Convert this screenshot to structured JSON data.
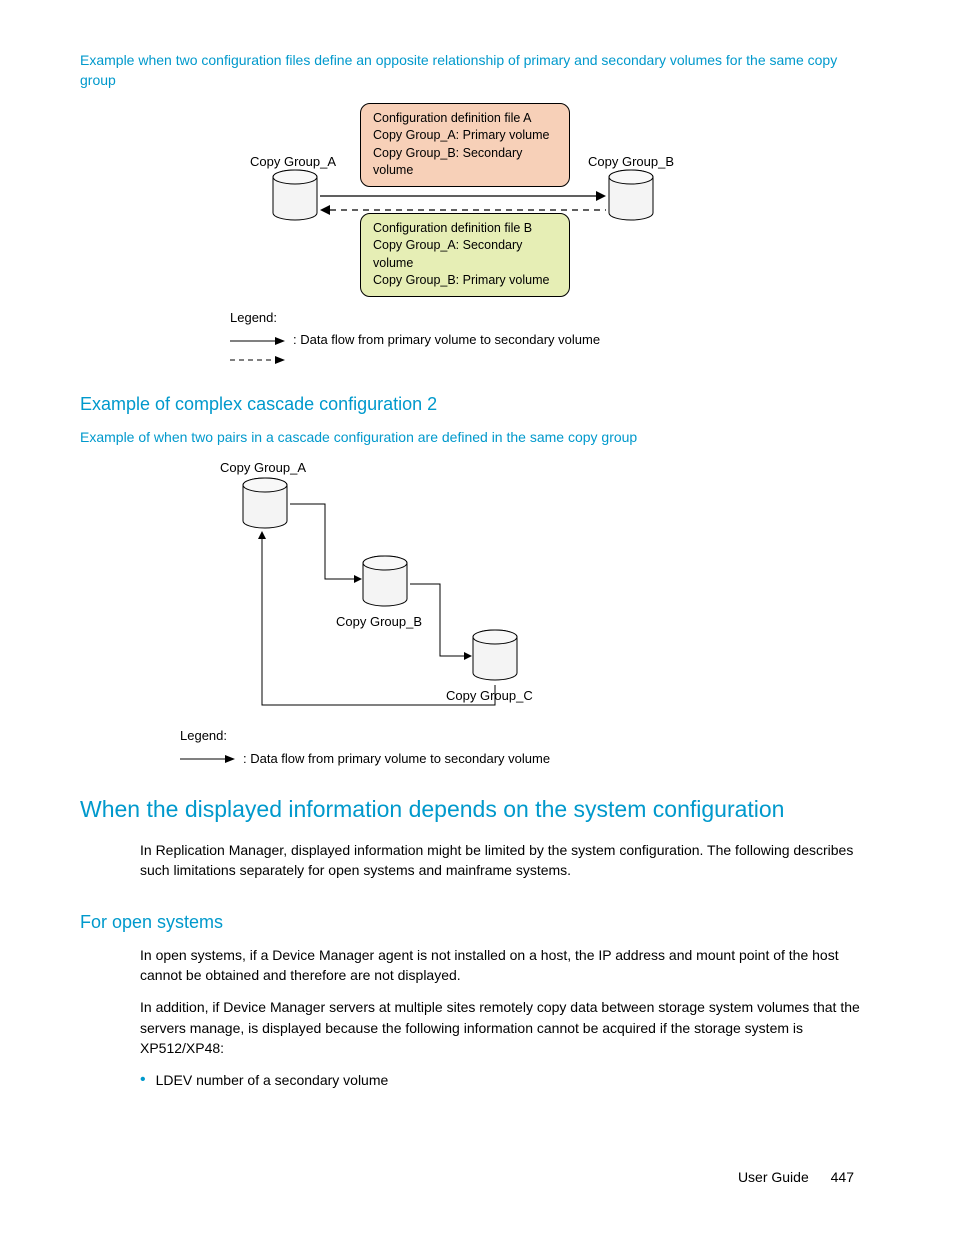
{
  "intro_link": "Example when two configuration files define an opposite relationship of primary and secondary volumes for the same copy group",
  "diagram1": {
    "boxA": {
      "line1": "Configuration definition file A",
      "line2": "Copy Group_A: Primary volume",
      "line3": "Copy Group_B: Secondary volume"
    },
    "boxB": {
      "line1": "Configuration definition file B",
      "line2": "Copy Group_A: Secondary volume",
      "line3": "Copy Group_B: Primary volume"
    },
    "leftLabel": "Copy Group_A",
    "rightLabel": "Copy Group_B",
    "legendTitle": "Legend:",
    "legendText": ": Data flow from primary volume to secondary volume"
  },
  "section2": {
    "heading": "Example of complex cascade configuration 2",
    "linkText": "Example of when two pairs in a cascade configuration are defined in the same copy group"
  },
  "diagram2": {
    "labelA": "Copy Group_A",
    "labelB": "Copy Group_B",
    "labelC": "Copy Group_C",
    "legendTitle": "Legend:",
    "legendText": ": Data flow from primary volume to secondary volume"
  },
  "section3": {
    "heading": "When the displayed information depends on the system configuration",
    "para": "In Replication Manager, displayed information might be limited by the system configuration. The following describes such limitations separately for open systems and mainframe systems."
  },
  "section4": {
    "heading": "For open systems",
    "para1": "In open systems, if a Device Manager agent is not installed on a host, the IP address and mount point of the host cannot be obtained and therefore are not displayed.",
    "para2": "In addition, if Device Manager servers at multiple sites remotely copy data between storage system volumes that the servers manage,         is displayed because the following information cannot be acquired if the storage system is XP512/XP48:",
    "bullet1": "LDEV number of a secondary volume"
  },
  "footer": {
    "title": "User Guide",
    "page": "447"
  }
}
